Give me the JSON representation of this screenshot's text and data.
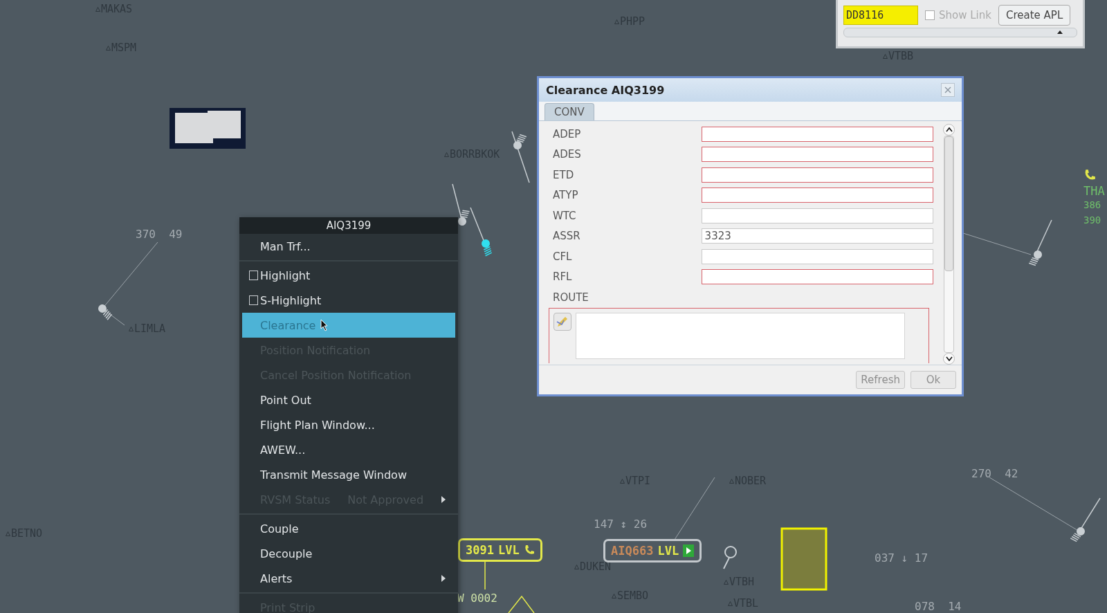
{
  "map": {
    "waypoints": [
      {
        "name": "MAKAS"
      },
      {
        "name": "MSPM"
      },
      {
        "name": "BORRBKOK"
      },
      {
        "name": "LIMLA"
      },
      {
        "name": "BETNO"
      },
      {
        "name": "VTPI"
      },
      {
        "name": "NOBER"
      },
      {
        "name": "DUKEN"
      },
      {
        "name": "SEMBO"
      },
      {
        "name": "VTBH"
      },
      {
        "name": "VTBL"
      },
      {
        "name": "VTBB"
      },
      {
        "name": "PHPP"
      }
    ],
    "readouts": [
      "370  49",
      "147 ↕ 26",
      "270  42",
      "037 ↓ 17",
      "078  14",
      "W 0002"
    ],
    "tags": [
      {
        "callsign": "3091",
        "status": "LVL",
        "kind": "phone",
        "color": "#e3e84a"
      },
      {
        "callsign": "AIQ663",
        "status": "LVL",
        "kind": "flag",
        "color": "#c3c8cc"
      }
    ],
    "side_label": {
      "lines": [
        "THA",
        "386",
        "390"
      ]
    }
  },
  "flight_search": {
    "value": "DD8116",
    "show_link": {
      "label": "Show Link",
      "checked": false
    },
    "button": "Create APL"
  },
  "menu": {
    "title": "AIQ3199",
    "items": [
      {
        "kind": "item",
        "label": "Man Trf...",
        "disabled": false,
        "selected": false,
        "submenu": false
      },
      {
        "kind": "separator"
      },
      {
        "kind": "checkbox",
        "label": "Highlight",
        "checked": false,
        "disabled": false,
        "selected": false,
        "submenu": false
      },
      {
        "kind": "checkbox",
        "label": "S-Highlight",
        "checked": false,
        "disabled": false,
        "selected": false,
        "submenu": false
      },
      {
        "kind": "item",
        "label": "Clearance",
        "disabled": false,
        "selected": true,
        "submenu": false
      },
      {
        "kind": "item",
        "label": "Position Notification",
        "disabled": true,
        "selected": false,
        "submenu": false
      },
      {
        "kind": "item",
        "label": "Cancel Position Notification",
        "disabled": true,
        "selected": false,
        "submenu": false
      },
      {
        "kind": "item",
        "label": "Point Out",
        "disabled": false,
        "selected": false,
        "submenu": false
      },
      {
        "kind": "item",
        "label": "Flight Plan Window...",
        "disabled": false,
        "selected": false,
        "submenu": false
      },
      {
        "kind": "item",
        "label": "AWEW...",
        "disabled": false,
        "selected": false,
        "submenu": false
      },
      {
        "kind": "item",
        "label": "Transmit Message Window",
        "disabled": false,
        "selected": false,
        "submenu": false
      },
      {
        "kind": "item",
        "label": "RVSM Status",
        "detail": "Not Approved",
        "disabled": true,
        "selected": false,
        "submenu": true
      },
      {
        "kind": "separator"
      },
      {
        "kind": "item",
        "label": "Couple",
        "disabled": false,
        "selected": false,
        "submenu": false
      },
      {
        "kind": "item",
        "label": "Decouple",
        "disabled": false,
        "selected": false,
        "submenu": false
      },
      {
        "kind": "item",
        "label": "Alerts",
        "disabled": false,
        "selected": false,
        "submenu": true
      },
      {
        "kind": "separator"
      },
      {
        "kind": "item",
        "label": "Print Strip",
        "disabled": true,
        "selected": false,
        "submenu": false
      }
    ]
  },
  "dialog": {
    "title": "Clearance AIQ3199",
    "tabs": [
      {
        "label": "CONV",
        "selected": true
      }
    ],
    "fields": [
      {
        "label": "ADEP",
        "invalid": true
      },
      {
        "label": "ADES",
        "invalid": true
      },
      {
        "label": "ETD",
        "invalid": true
      },
      {
        "label": "ATYP",
        "invalid": true
      },
      {
        "label": "WTC",
        "invalid": false
      },
      {
        "label": "ASSR",
        "value": "3323",
        "invalid": false
      },
      {
        "label": "CFL",
        "invalid": false
      },
      {
        "label": "RFL",
        "invalid": true
      }
    ],
    "route": {
      "label": "ROUTE",
      "invalid": true
    },
    "buttons": [
      {
        "label": "Refresh",
        "disabled": true
      },
      {
        "label": "Ok",
        "disabled": true
      }
    ]
  }
}
